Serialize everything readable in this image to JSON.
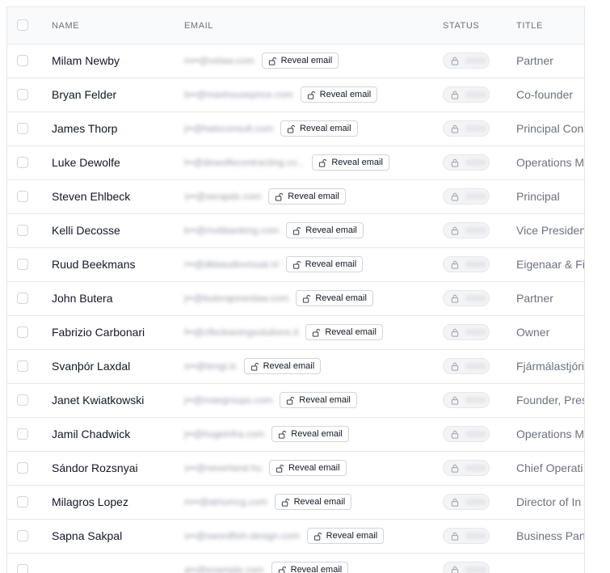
{
  "table": {
    "headers": {
      "name": "NAME",
      "email": "EMAIL",
      "status": "STATUS",
      "title": "TITLE"
    },
    "reveal_label": "Reveal email",
    "icons": {
      "reveal": "unlock-icon",
      "status": "lock-icon"
    },
    "rows": [
      {
        "name": "Milam Newby",
        "email": "m••@velaw.com",
        "title": "Partner"
      },
      {
        "name": "Bryan Felder",
        "email": "b••@maxhouseprice.com",
        "title": "Co-founder"
      },
      {
        "name": "James Thorp",
        "email": "j••@hatsconsult.com",
        "title": "Principal Con"
      },
      {
        "name": "Luke Dewolfe",
        "email": "l••@dewolfecontracting.co...",
        "title": "Operations M"
      },
      {
        "name": "Steven Ehlbeck",
        "email": "s••@serapdx.com",
        "title": "Principal"
      },
      {
        "name": "Kelli Decosse",
        "email": "k••@mvbbanking.com",
        "title": "Vice Presiden"
      },
      {
        "name": "Ruud Beekmans",
        "email": "r••@dkbaudiovisual.nl",
        "title": "Eigenaar & Fi"
      },
      {
        "name": "John Butera",
        "email": "j••@buterajoneslaw.com",
        "title": "Partner"
      },
      {
        "name": "Fabrizio Carbonari",
        "email": "f••@cfbcleaningsolutions.it",
        "title": "Owner"
      },
      {
        "name": "Svanþór Laxdal",
        "email": "s••@tengi.is",
        "title": "Fjármálastjóri"
      },
      {
        "name": "Janet Kwiatkowski",
        "email": "j••@maegroups.com",
        "title": "Founder, Pres"
      },
      {
        "name": "Jamil Chadwick",
        "email": "j••@hugeinfra.com",
        "title": "Operations M"
      },
      {
        "name": "Sándor Rozsnyai",
        "email": "s••@neverland.hu",
        "title": "Chief Operati"
      },
      {
        "name": "Milagros Lopez",
        "email": "m••@atriumcg.com",
        "title": "Director of In"
      },
      {
        "name": "Sapna Sakpal",
        "email": "s••@swordfish-design.com",
        "title": "Business Part"
      },
      {
        "name": "",
        "email": "a••@example.com",
        "title": ""
      }
    ]
  }
}
